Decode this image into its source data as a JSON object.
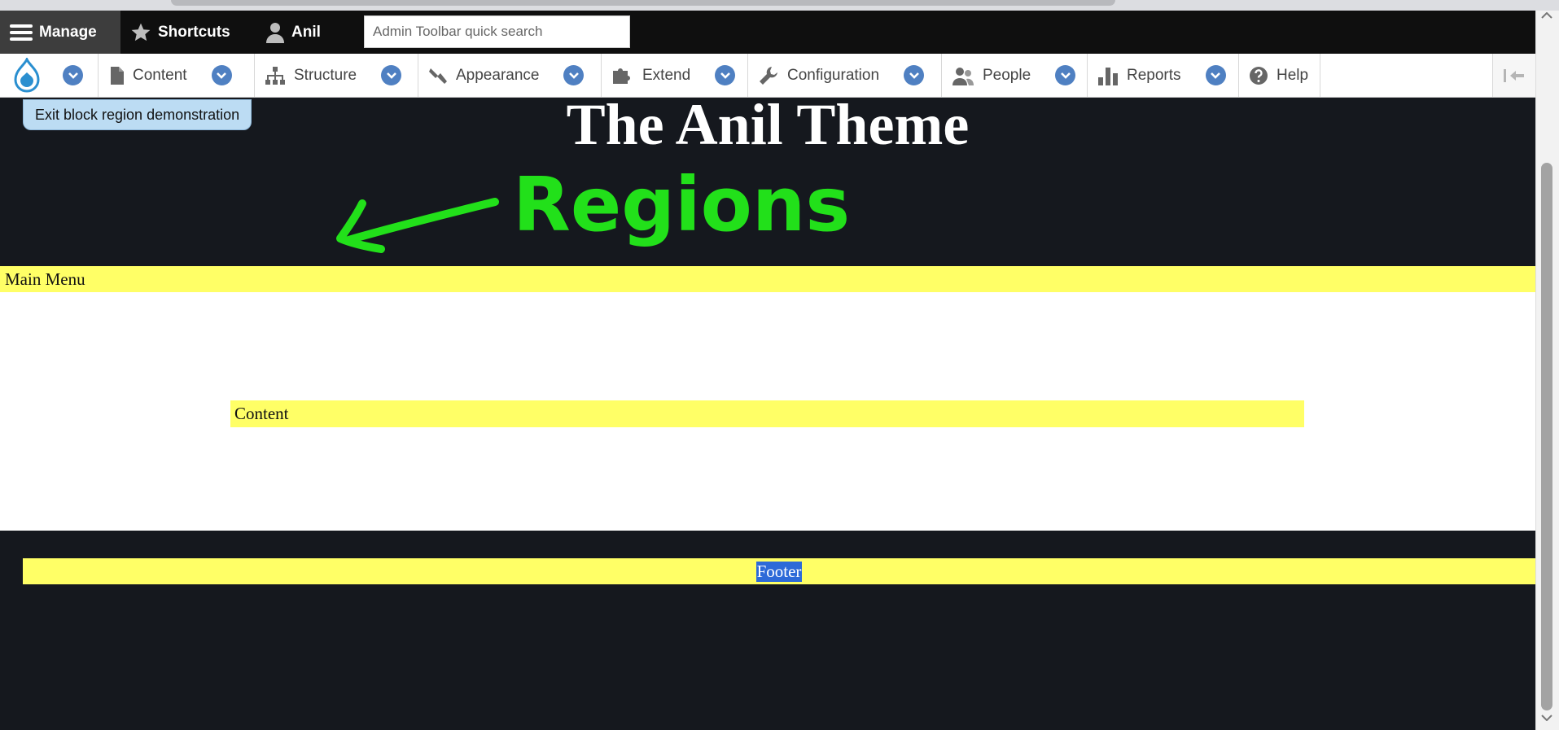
{
  "toolbar": {
    "manage_label": "Manage",
    "shortcuts_label": "Shortcuts",
    "user_label": "Anil",
    "search_placeholder": "Admin Toolbar quick search"
  },
  "tray": {
    "items": [
      {
        "label": "Content",
        "icon": "file-icon"
      },
      {
        "label": "Structure",
        "icon": "sitemap-icon"
      },
      {
        "label": "Appearance",
        "icon": "paintbrush-icon"
      },
      {
        "label": "Extend",
        "icon": "puzzle-icon"
      },
      {
        "label": "Configuration",
        "icon": "wrench-icon"
      },
      {
        "label": "People",
        "icon": "people-icon"
      },
      {
        "label": "Reports",
        "icon": "bar-chart-icon"
      },
      {
        "label": "Help",
        "icon": "help-icon"
      }
    ]
  },
  "page": {
    "exit_demo_label": "Exit block region demonstration",
    "site_title": "The Anil Theme",
    "annotation_text": "Regions",
    "regions": {
      "main_menu": "Main Menu",
      "content": "Content",
      "footer": "Footer"
    }
  },
  "colors": {
    "region_highlight": "#ffff66",
    "page_background": "#15181e",
    "annotation": "#22e01a",
    "accent": "#4f80c2"
  }
}
